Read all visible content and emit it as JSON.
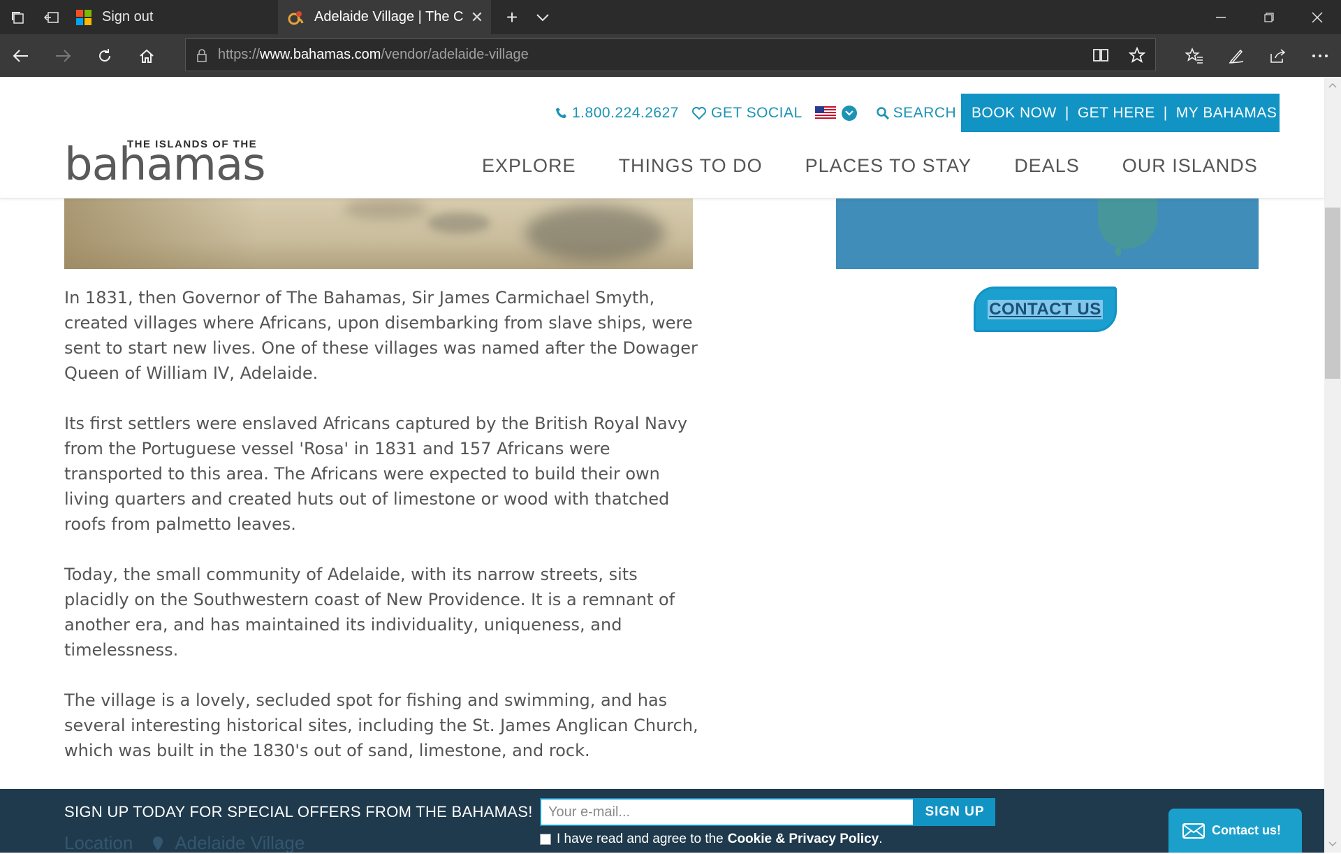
{
  "browser": {
    "tabs": [
      {
        "title": "Sign out",
        "active": false
      },
      {
        "title": "Adelaide Village | The C",
        "active": true
      }
    ],
    "url": {
      "scheme": "https://",
      "host": "www.bahamas.com",
      "path": "/vendor/adelaide-village"
    }
  },
  "header": {
    "logo_top": "THE ISLANDS OF THE",
    "logo_main": "bahamas",
    "phone": "1.800.224.2627",
    "get_social": "GET SOCIAL",
    "search": "SEARCH",
    "book_now": "BOOK NOW",
    "get_here": "GET HERE",
    "my_bahamas": "MY BAHAMAS",
    "separator": "|",
    "nav": [
      "EXPLORE",
      "THINGS TO DO",
      "PLACES TO STAY",
      "DEALS",
      "OUR ISLANDS"
    ]
  },
  "sidebar": {
    "contact_us": "CONTACT US"
  },
  "article": {
    "paragraphs": [
      "In 1831, then Governor of The Bahamas, Sir James Carmichael Smyth, created villages where Africans, upon disembarking from slave ships, were sent to start new lives. One of these villages was named after the Dowager Queen of William IV, Adelaide.",
      "Its first settlers were enslaved Africans captured by the British Royal Navy from the Portuguese vessel 'Rosa' in 1831 and 157 Africans were transported to this area. The Africans were expected to build their own living quarters and created huts out of limestone or wood with thatched roofs from palmetto leaves.",
      "Today, the small community of Adelaide, with its narrow streets, sits placidly on the Southwestern coast of New Providence. It is a remnant of another era, and has maintained its individuality, uniqueness, and timelessness.",
      "The village is a lovely, secluded spot for fishing and swimming, and has several interesting historical sites, including the St. James Anglican Church, which was built in the 1830's out of sand, limestone, and rock."
    ],
    "location_label": "Location",
    "location_value": "Adelaide Village"
  },
  "signup": {
    "text": "SIGN UP TODAY FOR SPECIAL OFFERS FROM THE BAHAMAS!",
    "email_placeholder": "Your e-mail...",
    "button": "SIGN UP",
    "agree_text": "I have read and agree to the",
    "policy_link": "Cookie & Privacy Policy",
    "agree_end": "."
  },
  "contact_float": "Contact us!",
  "colors": {
    "brand_blue": "#1193c4",
    "text_gray": "#555555",
    "signup_bg": "#163246"
  }
}
